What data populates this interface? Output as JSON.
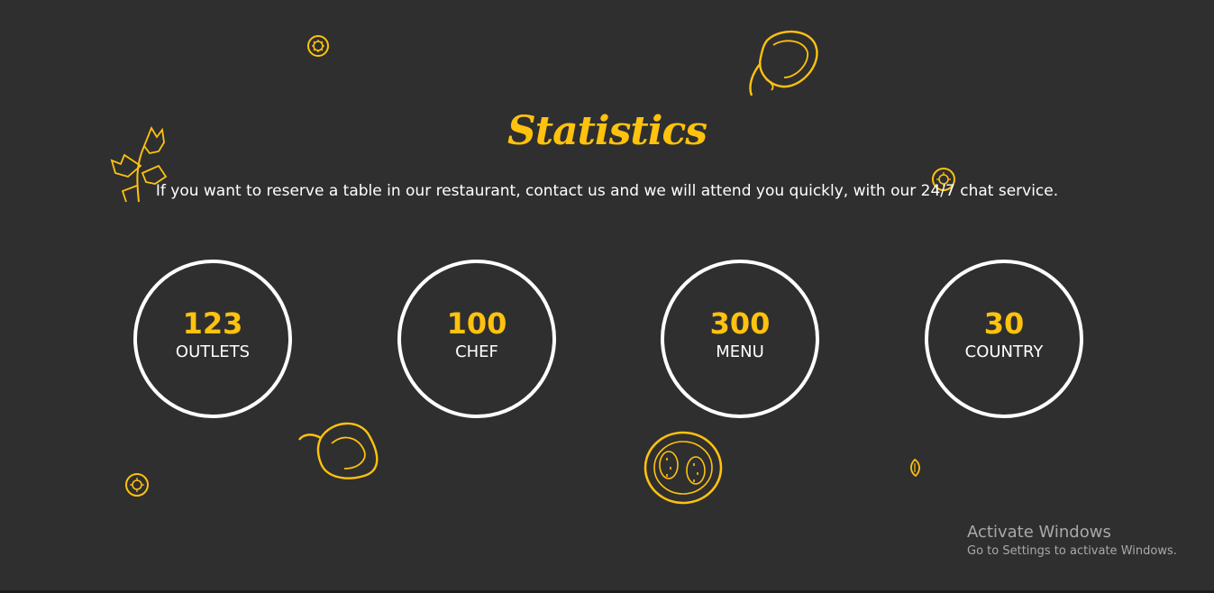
{
  "section": {
    "title": "Statistics",
    "subtitle": "If you want to reserve a table in our restaurant, contact us and we will attend you quickly, with our 24/7 chat service."
  },
  "stats": [
    {
      "value": "123",
      "label": "OUTLETS"
    },
    {
      "value": "100",
      "label": "CHEF"
    },
    {
      "value": "300",
      "label": "MENU"
    },
    {
      "value": "30",
      "label": "COUNTRY"
    }
  ],
  "decorations": [
    "pepper-icon",
    "parsley-icon",
    "lemon-slice-icon",
    "tomato-slice-icon",
    "seed-icon"
  ],
  "os_watermark": {
    "title": "Activate Windows",
    "subtitle": "Go to Settings to activate Windows."
  },
  "colors": {
    "background": "#2f2f2f",
    "accent": "#ffc20e",
    "text": "#ffffff"
  }
}
